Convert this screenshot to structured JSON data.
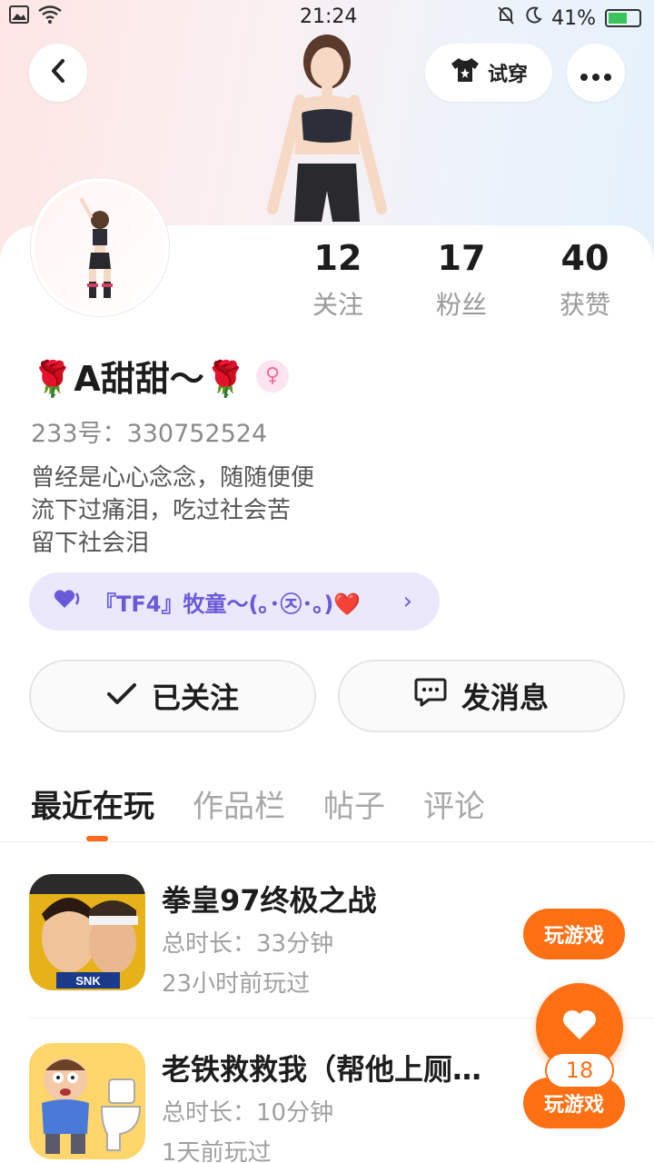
{
  "status_bar": {
    "time": "21:24",
    "battery": "41%"
  },
  "header": {
    "tryon_label": "试穿"
  },
  "stats": [
    {
      "value": "12",
      "label": "关注"
    },
    {
      "value": "17",
      "label": "粉丝"
    },
    {
      "value": "40",
      "label": "获赞"
    }
  ],
  "profile": {
    "name": "🌹A甜甜～🌹",
    "gender_symbol": "♀",
    "uid": "233号：330752524",
    "bio": [
      "曾经是心心念念，随随便便",
      "流下过痛泪，吃过社会苦",
      "留下社会泪"
    ],
    "guild": "『TF4』牧童～(｡･㉨･｡)❤️"
  },
  "actions": {
    "follow_label": "已关注",
    "message_label": "发消息"
  },
  "tabs": [
    "最近在玩",
    "作品栏",
    "帖子",
    "评论"
  ],
  "games": [
    {
      "title": "拳皇97终极之战",
      "duration": "总时长：33分钟",
      "last_played": "23小时前玩过",
      "button": "玩游戏"
    },
    {
      "title": "老铁救救我（帮他上厕所）",
      "duration": "总时长：10分钟",
      "last_played": "1天前玩过",
      "button": "玩游戏"
    }
  ],
  "like_fab": {
    "count": "18"
  },
  "colors": {
    "accent": "#ff7015",
    "guild": "#6a5ad8",
    "guild_bg": "#ebe8fb",
    "female": "#f06ba0"
  }
}
